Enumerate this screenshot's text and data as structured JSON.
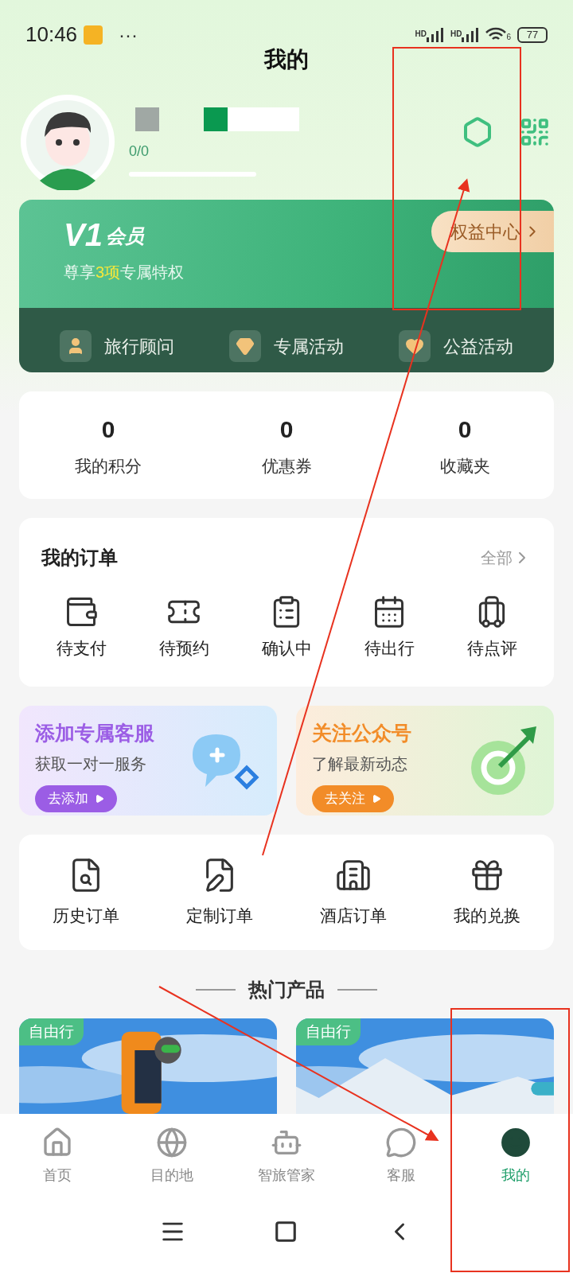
{
  "status_bar": {
    "time": "10:46",
    "more": "···",
    "signal_labels": [
      "HD",
      "HD"
    ],
    "wifi_label": "6",
    "battery": "77"
  },
  "header": {
    "title": "我的"
  },
  "profile": {
    "progress_text": "0/0"
  },
  "member_card": {
    "badge": "V1",
    "title": "会员",
    "subtitle": {
      "prefix": "尊享",
      "highlight": "3项",
      "suffix": "专属特权"
    },
    "link": "权益中心",
    "perks": [
      {
        "label": "旅行顾问"
      },
      {
        "label": "专属活动"
      },
      {
        "label": "公益活动"
      }
    ]
  },
  "stats": [
    {
      "value": "0",
      "label": "我的积分"
    },
    {
      "value": "0",
      "label": "优惠券"
    },
    {
      "value": "0",
      "label": "收藏夹"
    }
  ],
  "orders": {
    "title": "我的订单",
    "all": "全部",
    "items": [
      {
        "label": "待支付"
      },
      {
        "label": "待预约"
      },
      {
        "label": "确认中"
      },
      {
        "label": "待出行"
      },
      {
        "label": "待点评"
      }
    ]
  },
  "promos": [
    {
      "title": "添加专属客服",
      "subtitle": "获取一对一服务",
      "button": "去添加",
      "color": "#9b5de5"
    },
    {
      "title": "关注公众号",
      "subtitle": "了解最新动态",
      "button": "去关注",
      "color": "#f28c28"
    }
  ],
  "quick_links": [
    {
      "label": "历史订单"
    },
    {
      "label": "定制订单"
    },
    {
      "label": "酒店订单"
    },
    {
      "label": "我的兑换"
    }
  ],
  "hot_products": {
    "title": "热门产品",
    "items": [
      {
        "tag": "自由行",
        "kind": "picture"
      },
      {
        "tag": "自由行",
        "kind": "picture"
      }
    ]
  },
  "tab_bar": [
    {
      "label": "首页",
      "selected": false
    },
    {
      "label": "目的地",
      "selected": false
    },
    {
      "label": "智旅管家",
      "selected": false
    },
    {
      "label": "客服",
      "selected": false
    },
    {
      "label": "我的",
      "selected": true
    }
  ]
}
